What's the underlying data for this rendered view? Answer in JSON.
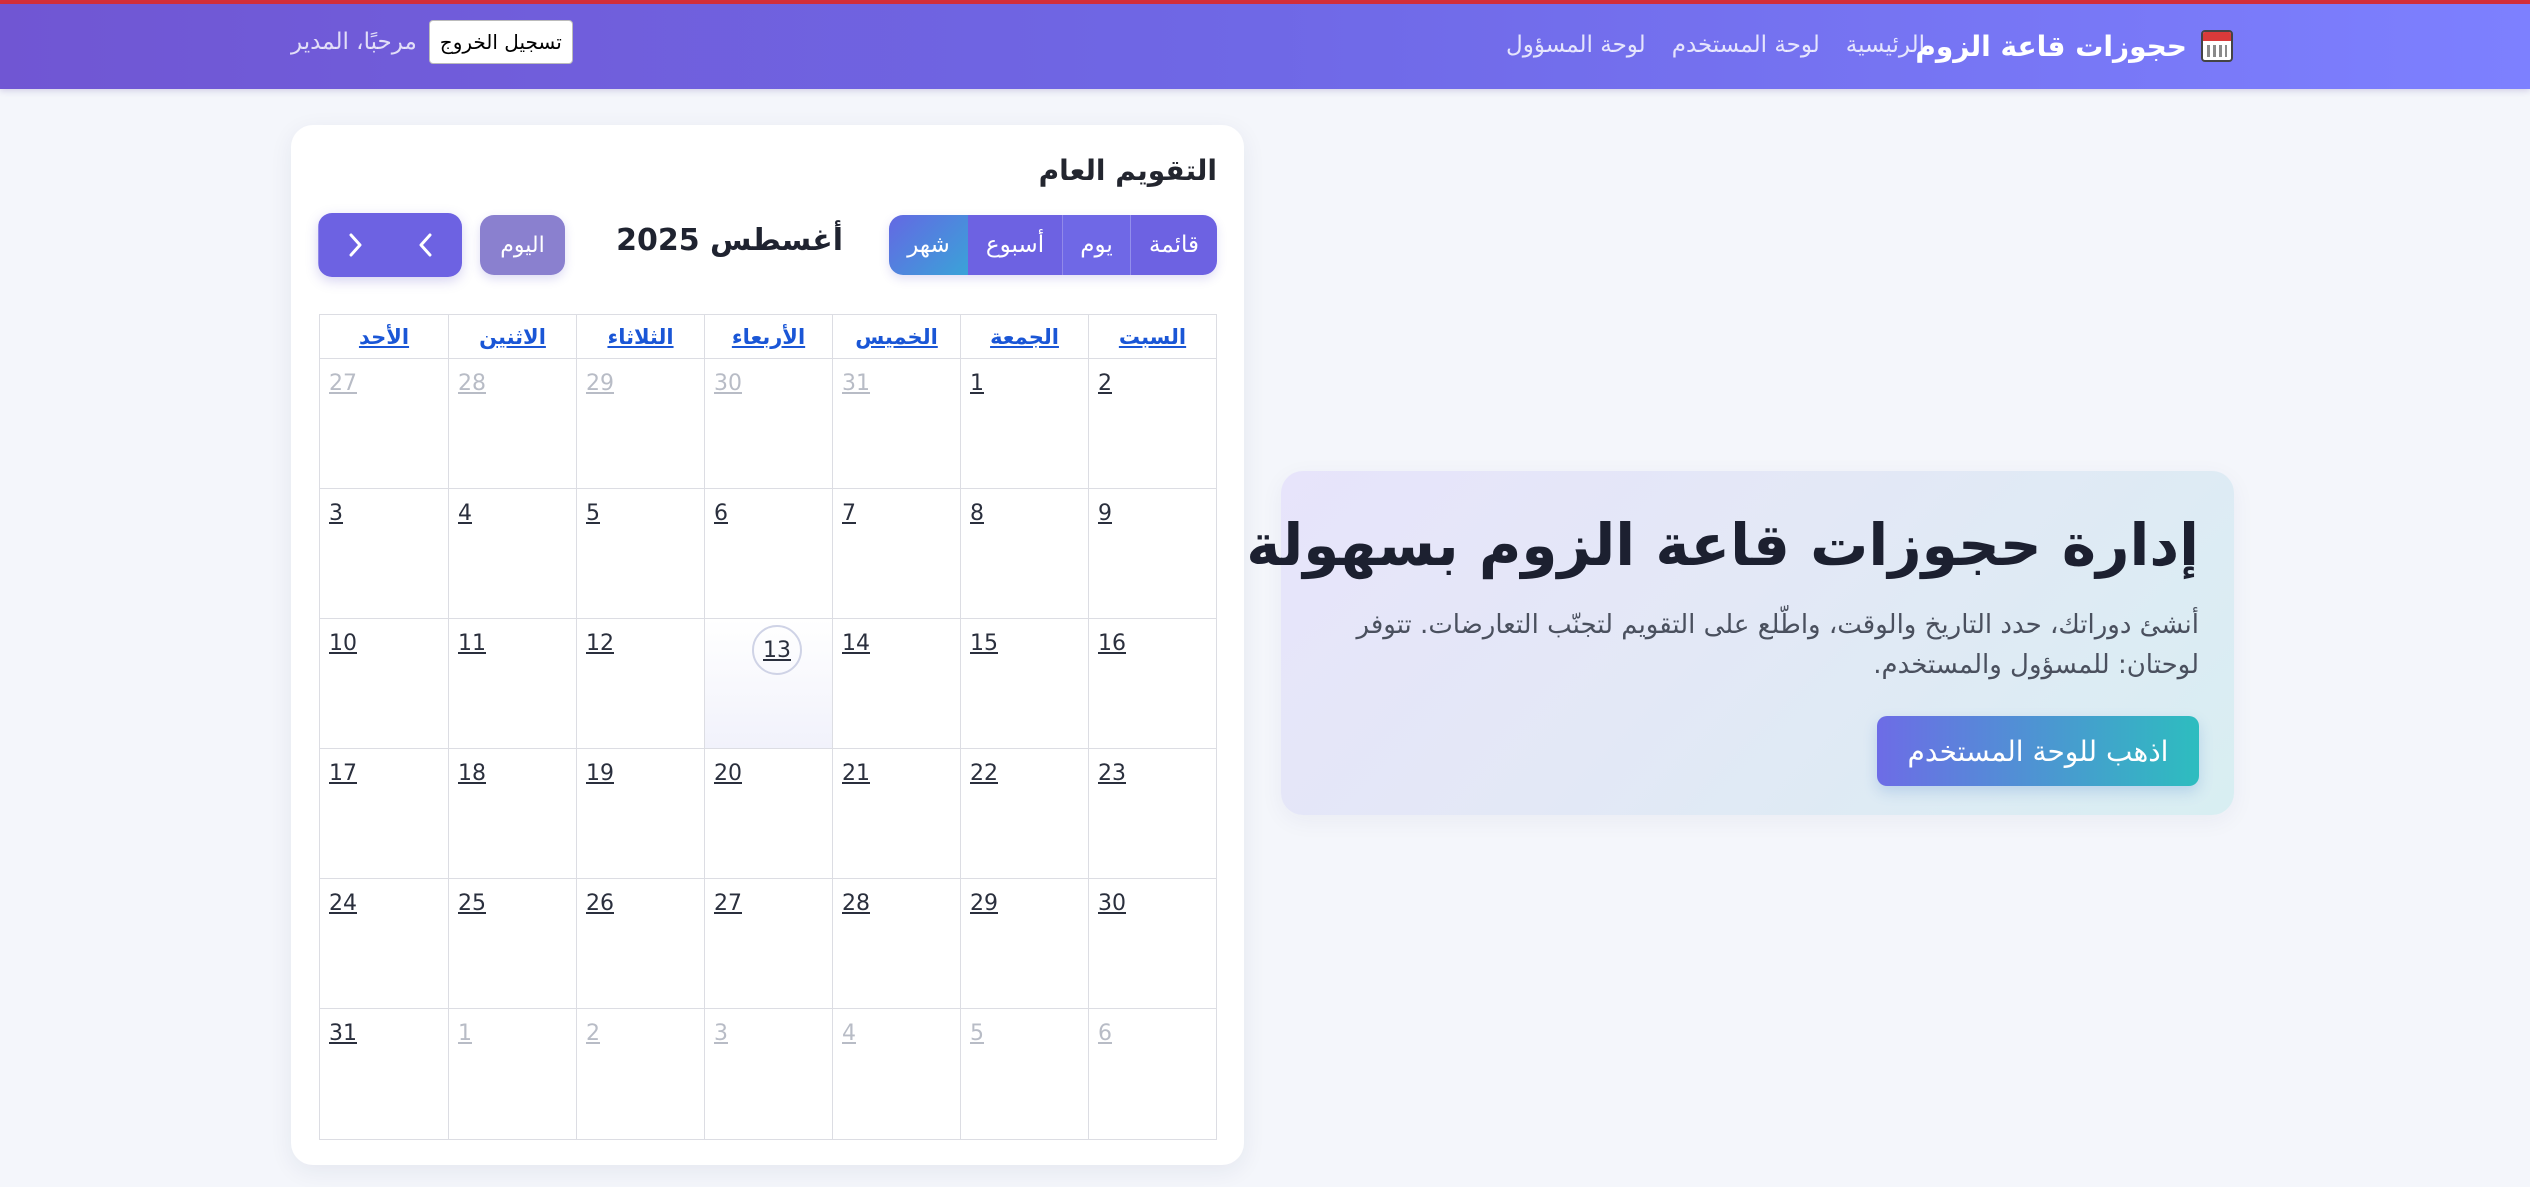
{
  "nav": {
    "brand": "حجوزات قاعة الزوم",
    "brand_icon": "calendar-icon",
    "links": [
      "الرئيسية",
      "لوحة المستخدم",
      "لوحة المسؤول"
    ],
    "welcome": "مرحبًا، المدير",
    "logout": "تسجيل الخروج"
  },
  "calendar": {
    "title": "التقويم العام",
    "views": {
      "list": "قائمة",
      "day": "يوم",
      "week": "أسبوع",
      "month": "شهر"
    },
    "active_view": "شهر",
    "month_label": "أغسطس 2025",
    "today": "اليوم",
    "prev_icon": "chevron-left-icon",
    "next_icon": "chevron-right-icon",
    "weekdays": [
      "السبت",
      "الجمعة",
      "الخميس",
      "الأربعاء",
      "الثلاثاء",
      "الاثنين",
      "الأحد"
    ],
    "today_date": "13",
    "weeks": [
      [
        {
          "d": "2",
          "o": false
        },
        {
          "d": "1",
          "o": false
        },
        {
          "d": "31",
          "o": true
        },
        {
          "d": "30",
          "o": true
        },
        {
          "d": "29",
          "o": true
        },
        {
          "d": "28",
          "o": true
        },
        {
          "d": "27",
          "o": true
        }
      ],
      [
        {
          "d": "9",
          "o": false
        },
        {
          "d": "8",
          "o": false
        },
        {
          "d": "7",
          "o": false
        },
        {
          "d": "6",
          "o": false
        },
        {
          "d": "5",
          "o": false
        },
        {
          "d": "4",
          "o": false
        },
        {
          "d": "3",
          "o": false
        }
      ],
      [
        {
          "d": "16",
          "o": false
        },
        {
          "d": "15",
          "o": false
        },
        {
          "d": "14",
          "o": false
        },
        {
          "d": "13",
          "o": false,
          "t": true
        },
        {
          "d": "12",
          "o": false
        },
        {
          "d": "11",
          "o": false
        },
        {
          "d": "10",
          "o": false
        }
      ],
      [
        {
          "d": "23",
          "o": false
        },
        {
          "d": "22",
          "o": false
        },
        {
          "d": "21",
          "o": false
        },
        {
          "d": "20",
          "o": false
        },
        {
          "d": "19",
          "o": false
        },
        {
          "d": "18",
          "o": false
        },
        {
          "d": "17",
          "o": false
        }
      ],
      [
        {
          "d": "30",
          "o": false
        },
        {
          "d": "29",
          "o": false
        },
        {
          "d": "28",
          "o": false
        },
        {
          "d": "27",
          "o": false
        },
        {
          "d": "26",
          "o": false
        },
        {
          "d": "25",
          "o": false
        },
        {
          "d": "24",
          "o": false
        }
      ],
      [
        {
          "d": "6",
          "o": true
        },
        {
          "d": "5",
          "o": true
        },
        {
          "d": "4",
          "o": true
        },
        {
          "d": "3",
          "o": true
        },
        {
          "d": "2",
          "o": true
        },
        {
          "d": "1",
          "o": true
        },
        {
          "d": "31",
          "o": false
        }
      ]
    ]
  },
  "hero": {
    "title": "إدارة حجوزات قاعة الزوم بسهولة",
    "description": "أنشئ دوراتك، حدد التاريخ والوقت، واطّلع على التقويم لتجنّب التعارضات. تتوفر لوحتان: للمسؤول والمستخدم.",
    "cta": "اذهب للوحة المستخدم"
  }
}
